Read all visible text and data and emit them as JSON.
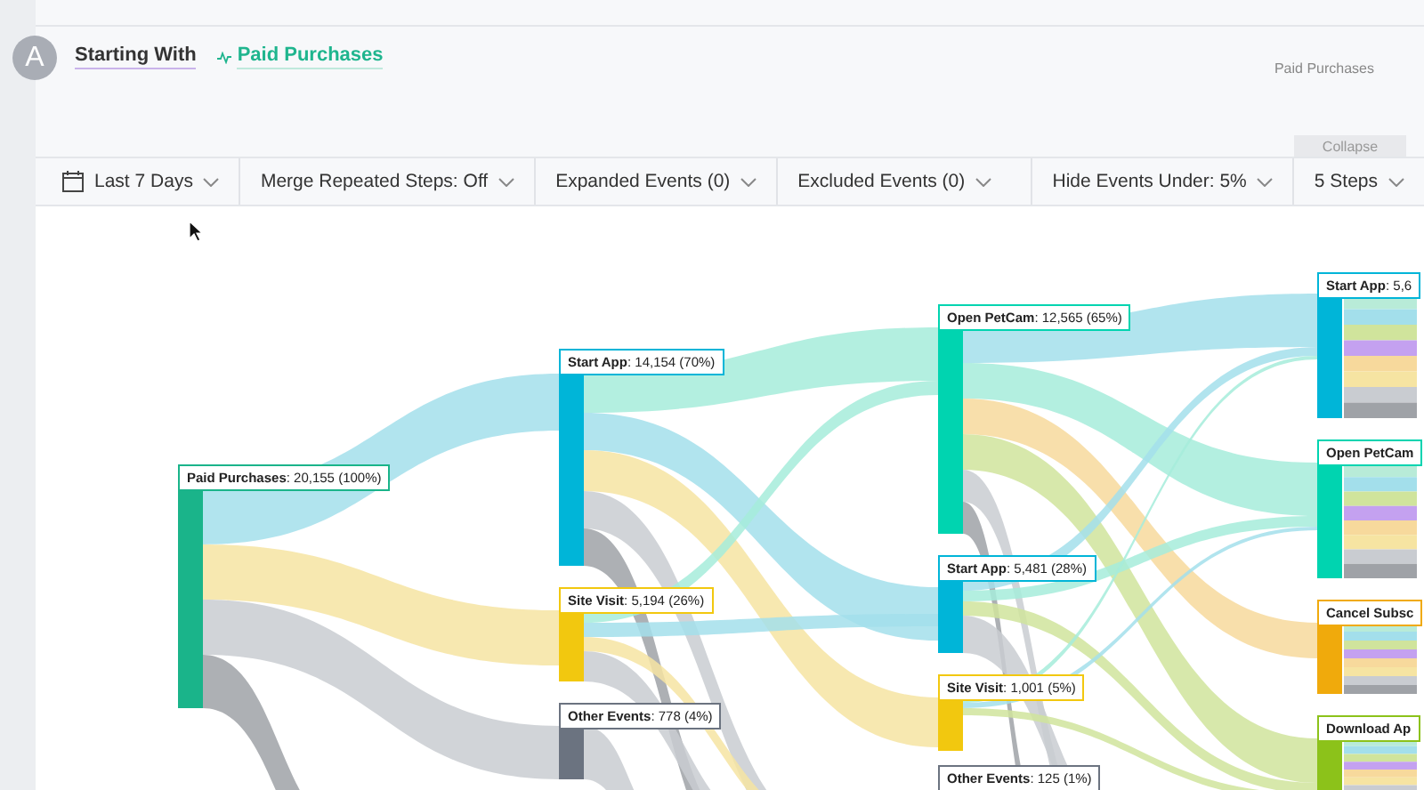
{
  "header": {
    "avatar": "A",
    "starting_label": "Starting With",
    "event": "Paid Purchases",
    "side_label": "Paid Purchases",
    "collapse": "Collapse"
  },
  "toolbar": {
    "left": [
      {
        "label": "Last 7 Days",
        "kind": "date"
      },
      {
        "label": "Merge Repeated Steps: Off",
        "kind": "dropdown"
      },
      {
        "label": "Expanded Events (0)",
        "kind": "dropdown"
      },
      {
        "label": "Excluded Events (0)",
        "kind": "dropdown"
      }
    ],
    "right": [
      {
        "label": "Hide Events Under: 5%",
        "kind": "dropdown"
      },
      {
        "label": "5 Steps",
        "kind": "dropdown"
      }
    ]
  },
  "journey_chart": {
    "columns": [
      {
        "nodes": [
          {
            "label": "**Paid Purchases**: 20,155 (100%)",
            "color": "#1ab48a"
          }
        ]
      },
      {
        "nodes": [
          {
            "label": "**Start App**: 14,154 (70%)",
            "color": "#00b5d8"
          },
          {
            "label": "**Site Visit**: 5,194 (26%)",
            "color": "#f2c80f"
          },
          {
            "label": "**Other Events**: 778 (4%)",
            "color": "#6b7380"
          }
        ]
      },
      {
        "nodes": [
          {
            "label": "**Open PetCam**: 12,565 (65%)",
            "color": "#00d4b0"
          },
          {
            "label": "**Start App**: 5,481 (28%)",
            "color": "#00b5d8"
          },
          {
            "label": "**Site Visit**: 1,001 (5%)",
            "color": "#f2c80f"
          },
          {
            "label": "**Other Events**: 125 (1%)",
            "color": "#6b7380"
          }
        ]
      },
      {
        "nodes": [
          {
            "label": "**Start App**: 5,6",
            "color": "#00b5d8"
          },
          {
            "label": "**Open PetCam**",
            "color": "#00d4b0"
          },
          {
            "label": "**Cancel Subsc**",
            "color": "#f0aa0c"
          },
          {
            "label": "**Download Ap**",
            "color": "#8cc21a"
          }
        ]
      }
    ]
  }
}
